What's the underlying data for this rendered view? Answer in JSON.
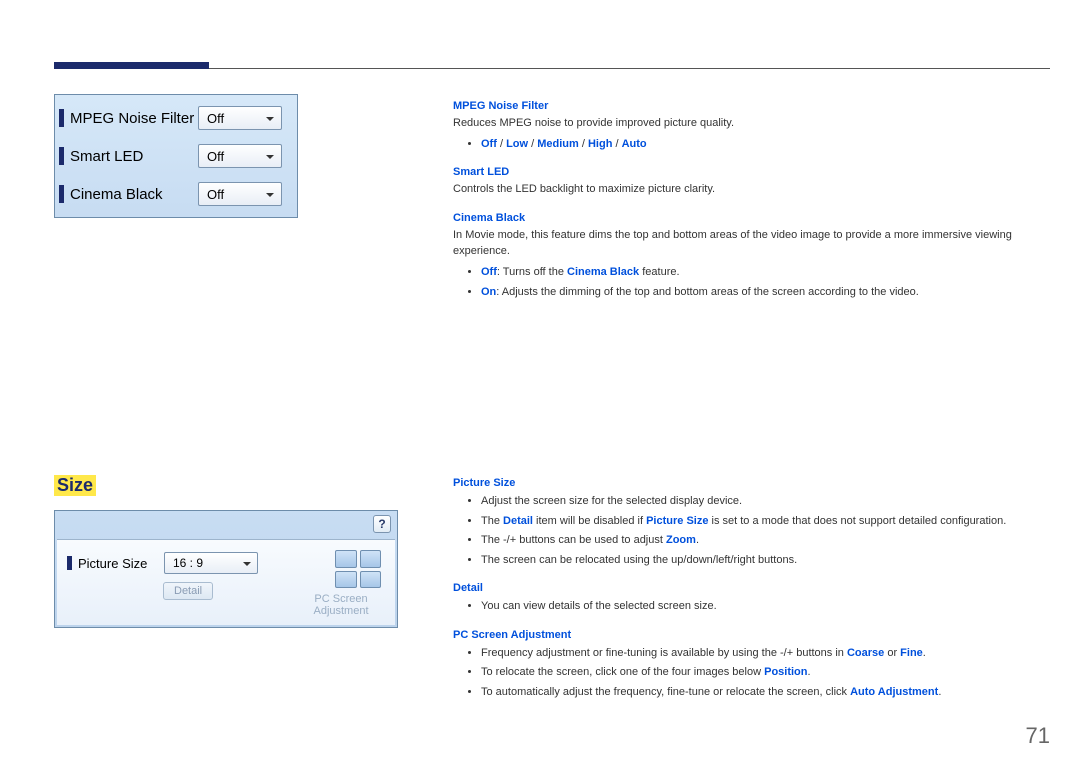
{
  "page_number": "71",
  "panel1": {
    "rows": [
      {
        "label": "MPEG Noise Filter",
        "value": "Off"
      },
      {
        "label": "Smart LED",
        "value": "Off"
      },
      {
        "label": "Cinema Black",
        "value": "Off"
      }
    ]
  },
  "size_heading": "Size",
  "panel2": {
    "help": "?",
    "picture_size_label": "Picture Size",
    "picture_size_value": "16 : 9",
    "detail_btn": "Detail",
    "pc_screen_l1": "PC Screen",
    "pc_screen_l2": "Adjustment"
  },
  "desc": {
    "mpeg_hd": "MPEG Noise Filter",
    "mpeg_txt": "Reduces MPEG noise to provide improved picture quality.",
    "mpeg_opts_off": "Off",
    "mpeg_opts_low": "Low",
    "mpeg_opts_med": "Medium",
    "mpeg_opts_high": "High",
    "mpeg_opts_auto": "Auto",
    "sep": " / ",
    "smartled_hd": "Smart LED",
    "smartled_txt": "Controls the LED backlight to maximize picture clarity.",
    "cinema_hd": "Cinema Black",
    "cinema_txt": "In Movie mode, this feature dims the top and bottom areas of the video image to provide a more immersive viewing experience.",
    "cinema_off_label": "Off",
    "cinema_off_txt": ": Turns off the ",
    "cinema_off_feat": "Cinema Black",
    "cinema_off_txt2": " feature.",
    "cinema_on_label": "On",
    "cinema_on_txt": ": Adjusts the dimming of the top and bottom areas of the screen according to the video.",
    "psize_hd": "Picture Size",
    "psize_b1": "Adjust the screen size for the selected display device.",
    "psize_b2a": "The ",
    "psize_b2b": "Detail",
    "psize_b2c": " item will be disabled if ",
    "psize_b2d": "Picture Size",
    "psize_b2e": " is set to a mode that does not support detailed configuration.",
    "psize_b3a": "The -/+ buttons can be used to adjust ",
    "psize_b3b": "Zoom",
    "psize_b3c": ".",
    "psize_b4": "The screen can be relocated using the up/down/left/right buttons.",
    "detail_hd": "Detail",
    "detail_b1": "You can view details of the selected screen size.",
    "pcadj_hd": "PC Screen Adjustment",
    "pcadj_b1a": "Frequency adjustment or fine-tuning is available by using the -/+ buttons in ",
    "pcadj_b1b": "Coarse",
    "pcadj_b1c": " or ",
    "pcadj_b1d": "Fine",
    "pcadj_b1e": ".",
    "pcadj_b2a": "To relocate the screen, click one of the four images below ",
    "pcadj_b2b": "Position",
    "pcadj_b2c": ".",
    "pcadj_b3a": "To automatically adjust the frequency, fine-tune or relocate the screen, click ",
    "pcadj_b3b": "Auto Adjustment",
    "pcadj_b3c": "."
  }
}
